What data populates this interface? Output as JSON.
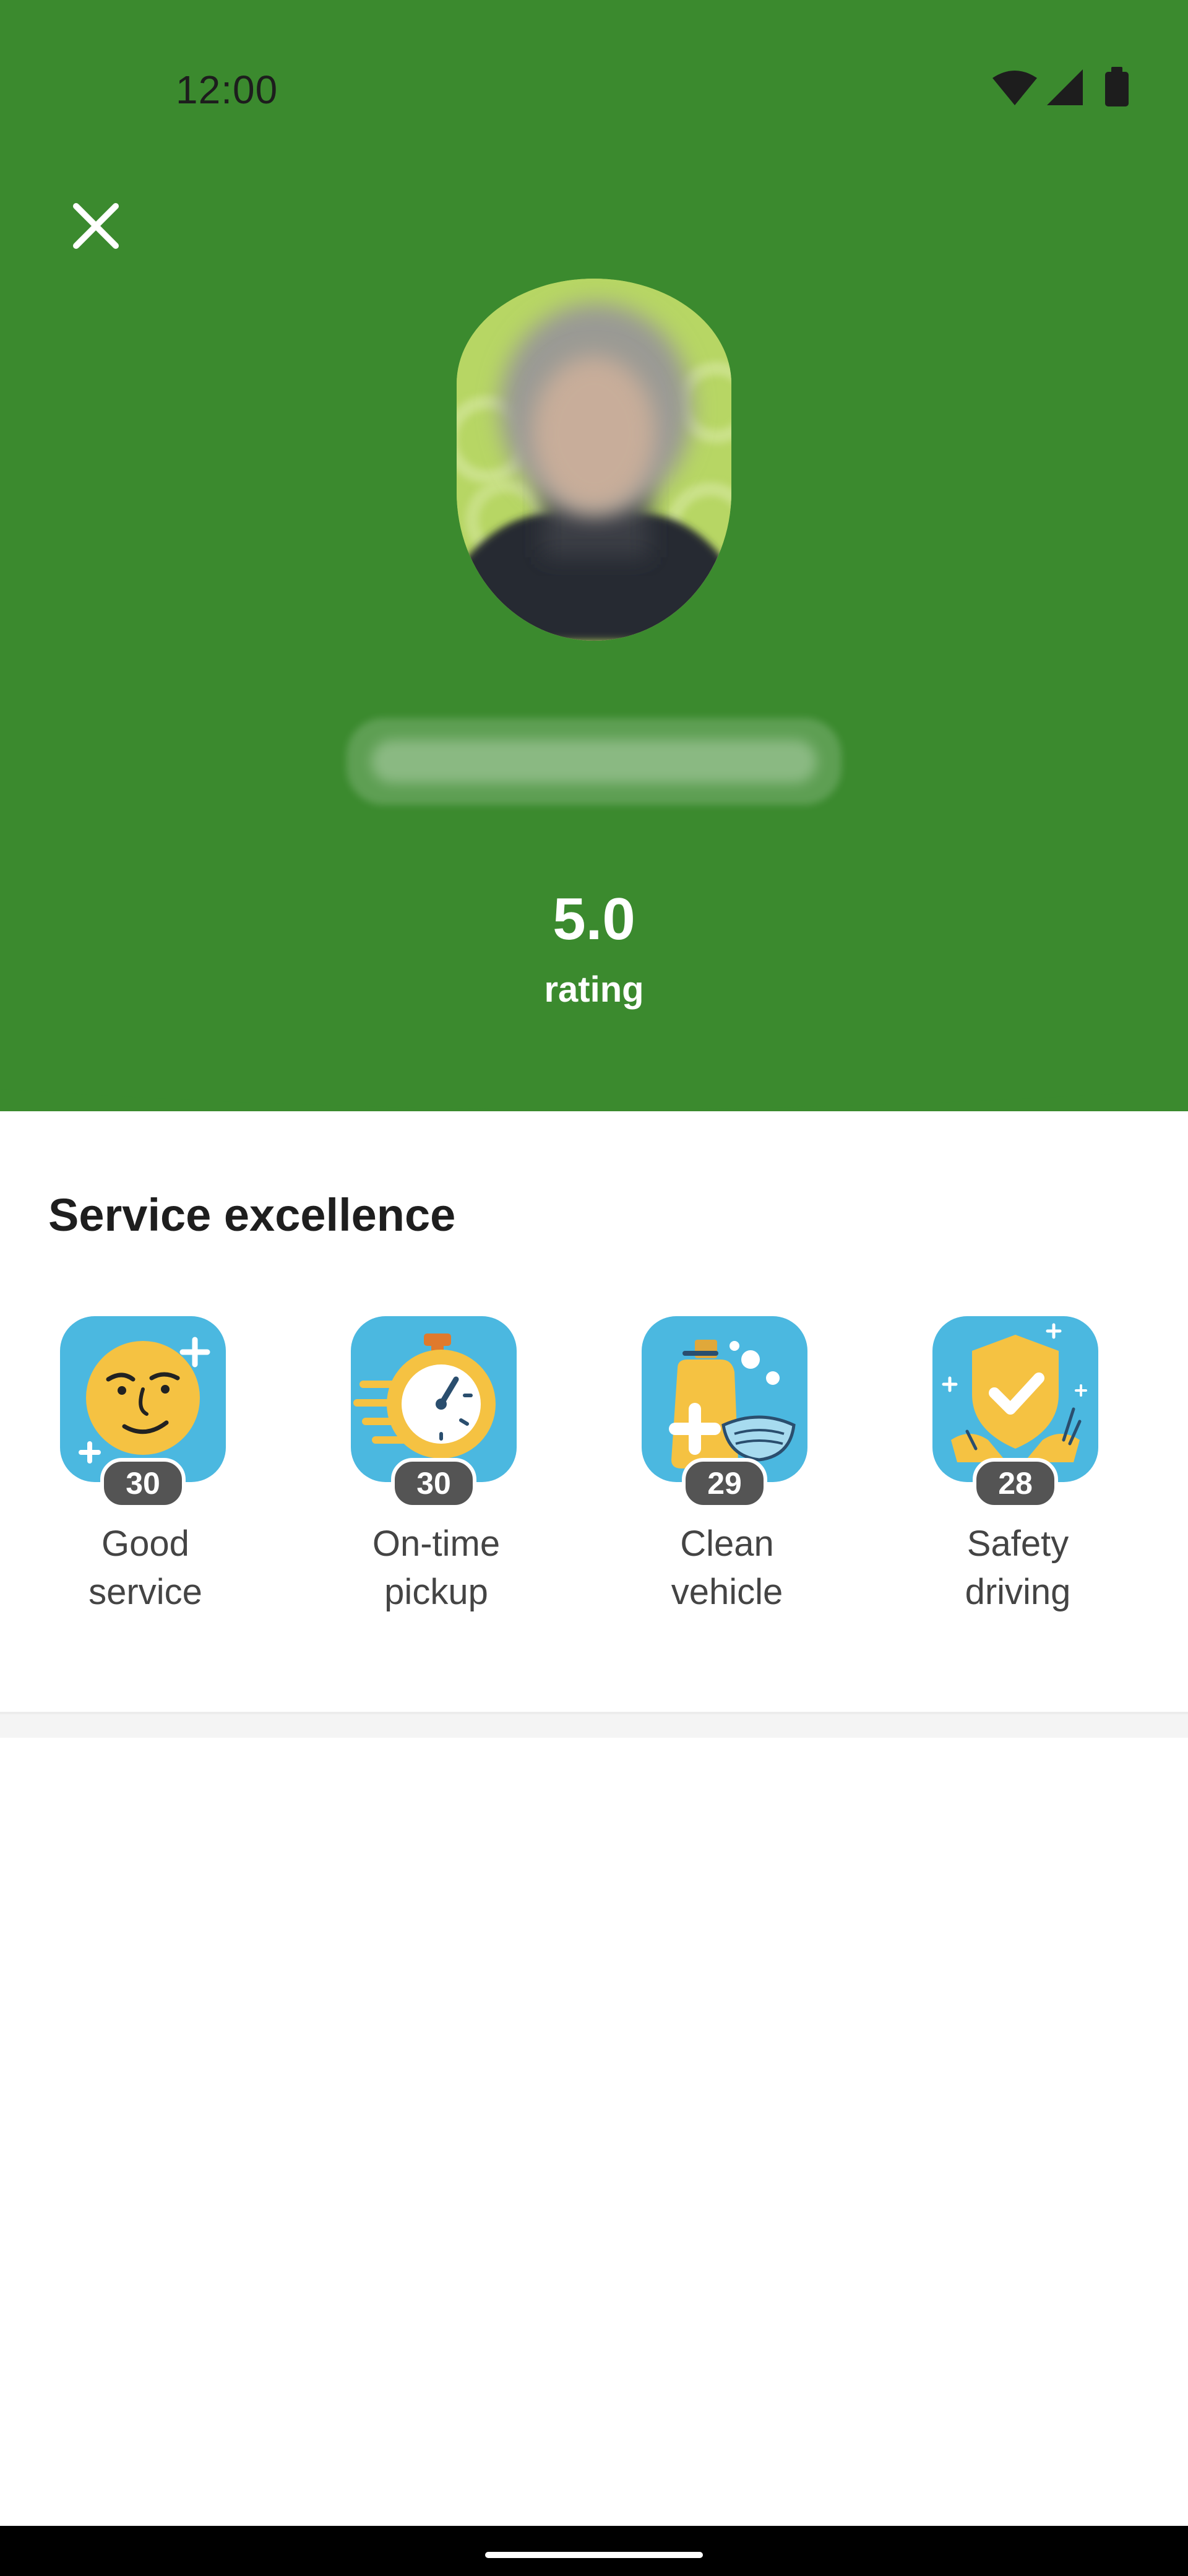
{
  "status_bar": {
    "time": "12:00",
    "icons": [
      "wifi-icon",
      "signal-icon",
      "battery-icon"
    ]
  },
  "header": {
    "close_icon": "close-icon",
    "rating_value": "5.0",
    "rating_label": "rating"
  },
  "colors": {
    "header_green": "#3b8a2e",
    "badge_blue": "#4bb8e0",
    "count_badge": "#545454"
  },
  "section": {
    "title": "Service excellence",
    "badges": [
      {
        "icon": "smiling-face-icon",
        "count": "30",
        "label_line1": "Good",
        "label_line2": "service"
      },
      {
        "icon": "stopwatch-icon",
        "count": "30",
        "label_line1": "On-time",
        "label_line2": "pickup"
      },
      {
        "icon": "sanitizer-mask-icon",
        "count": "29",
        "label_line1": "Clean",
        "label_line2": "vehicle"
      },
      {
        "icon": "shield-check-icon",
        "count": "28",
        "label_line1": "Safety",
        "label_line2": "driving"
      }
    ]
  }
}
